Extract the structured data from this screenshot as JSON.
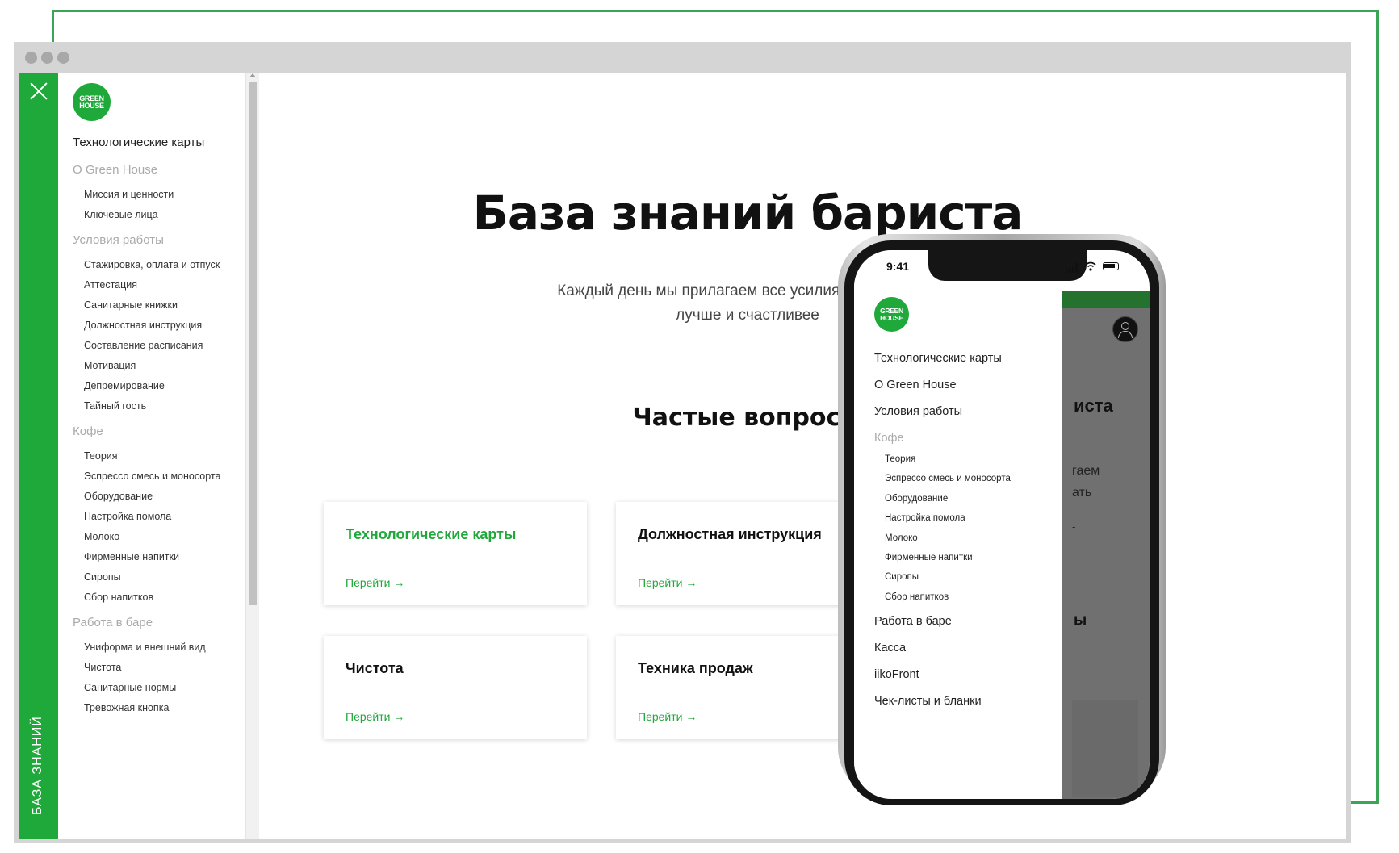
{
  "browser": {
    "window_controls": [
      "close",
      "minimize",
      "maximize"
    ]
  },
  "vertical_label": "БАЗА ЗНАНИЙ",
  "logo_text": [
    "GREEN",
    "HOUSE"
  ],
  "sidebar": {
    "sections": [
      {
        "label": "Технологические карты",
        "muted": false,
        "items": []
      },
      {
        "label": "O Green House",
        "muted": true,
        "items": [
          "Миссия и ценности",
          "Ключевые лица"
        ]
      },
      {
        "label": "Условия работы",
        "muted": true,
        "items": [
          "Стажировка, оплата и отпуск",
          "Аттестация",
          "Санитарные книжки",
          "Должностная инструкция",
          "Составление расписания",
          "Мотивация",
          "Депремирование",
          "Тайный гость"
        ]
      },
      {
        "label": "Кофе",
        "muted": true,
        "items": [
          "Теория",
          "Эспрессо смесь и моносорта",
          "Оборудование",
          "Настройка помола",
          "Молоко",
          "Фирменные напитки",
          "Сиропы",
          "Сбор напитков"
        ]
      },
      {
        "label": "Работа в баре",
        "muted": true,
        "items": [
          "Униформа и внешний вид",
          "Чистота",
          "Санитарные нормы",
          "Тревожная кнопка"
        ]
      }
    ]
  },
  "main": {
    "title": "База знаний бариста",
    "subtitle_line1": "Каждый день мы прилагаем все усилия, чтобы сдела",
    "subtitle_line2": "лучше и счастливее",
    "faq_title": "Частые вопросы",
    "cards": [
      {
        "title": "Технологические карты",
        "link": "Перейти →",
        "highlight": true
      },
      {
        "title": "Должностная инструкция",
        "link": "Перейти →",
        "highlight": false
      },
      {
        "title": "Чистота",
        "link": "Перейти →",
        "highlight": false
      },
      {
        "title": "Техника продаж",
        "link": "Перейти →",
        "highlight": false
      }
    ]
  },
  "phone": {
    "time": "9:41",
    "behind": {
      "title_fragment": "иста",
      "text_line1": "гаем",
      "text_line2": "ать",
      "dot": "-",
      "faq_fragment": "ы"
    },
    "drawer": {
      "sections": [
        {
          "label": "Технологические карты",
          "muted": false,
          "items": []
        },
        {
          "label": "O Green House",
          "muted": false,
          "items": []
        },
        {
          "label": "Условия работы",
          "muted": false,
          "items": []
        },
        {
          "label": "Кофе",
          "muted": true,
          "items": [
            "Теория",
            "Эспрессо смесь и моносорта",
            "Оборудование",
            "Настройка помола",
            "Молоко",
            "Фирменные напитки",
            "Сиропы",
            "Сбор напитков"
          ]
        },
        {
          "label": "Работа в баре",
          "muted": false,
          "items": []
        },
        {
          "label": "Касса",
          "muted": false,
          "items": []
        },
        {
          "label": "iikoFront",
          "muted": false,
          "items": []
        },
        {
          "label": "Чек-листы и бланки",
          "muted": false,
          "items": []
        }
      ]
    }
  },
  "colors": {
    "brand_green": "#1fa93a",
    "dark_green": "#25722f",
    "muted_text": "#aaaaaa",
    "frame": "#d5d5d5"
  }
}
